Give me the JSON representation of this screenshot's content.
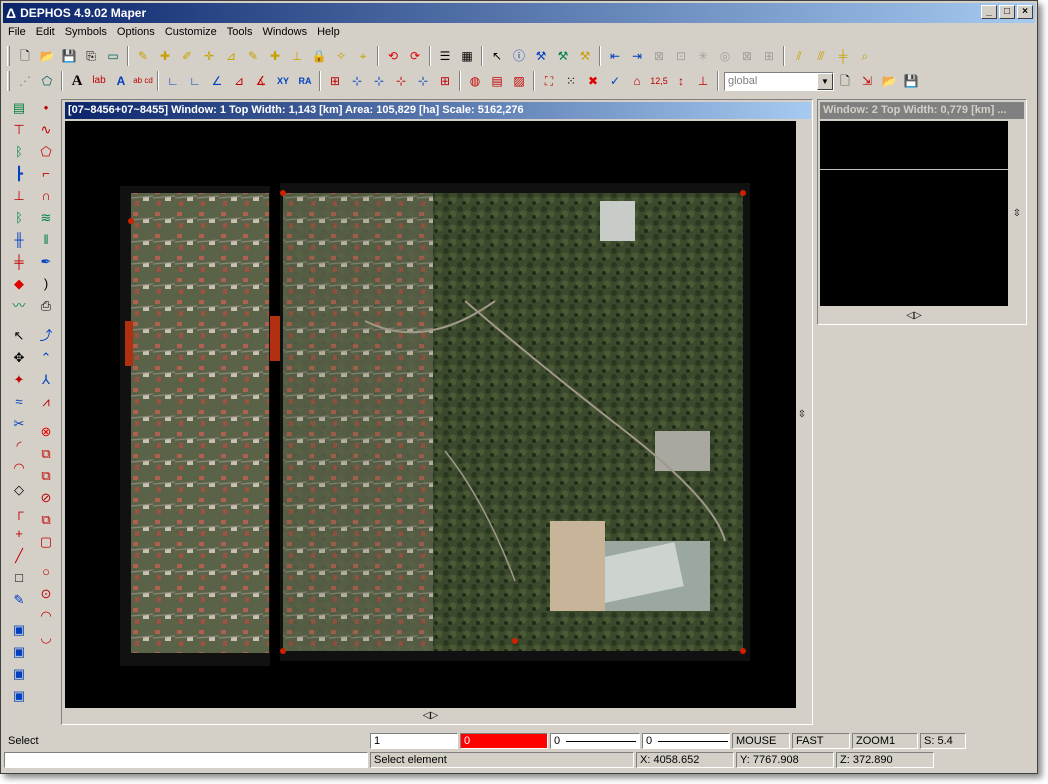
{
  "window": {
    "title": "DEPHOS 4.9.02 Maper",
    "controls": [
      "minimize",
      "maximize",
      "close"
    ]
  },
  "menu": [
    "File",
    "Edit",
    "Symbols",
    "Options",
    "Customize",
    "Tools",
    "Windows",
    "Help"
  ],
  "toolbar": {
    "layer_combo": "global",
    "text_labels": [
      "A",
      "lab",
      "A",
      "ab cd",
      "XY",
      "RA",
      "12,5"
    ]
  },
  "map_window": {
    "title": "[07~8456+07~8455] Window: 1 Top Width: 1,143 [km] Area: 105,829 [ha] Scale: 5162,276"
  },
  "window2": {
    "title": "Window: 2 Top Width: 0,779 [km] ..."
  },
  "status": {
    "mode": "Select",
    "field1": "1",
    "field2": "0",
    "field3": "0",
    "field4": "0",
    "input": "MOUSE",
    "speed": "FAST",
    "zoom": "ZOOM1",
    "scale": "S:  5.4",
    "hint": "Select element",
    "x": "X: 4058.652",
    "y": "Y: 7767.908",
    "z": "Z:  372.890"
  },
  "icons": {
    "palette": [
      "#c00000",
      "#0000c0",
      "#008000",
      "#e0c000",
      "#ff0000"
    ]
  }
}
